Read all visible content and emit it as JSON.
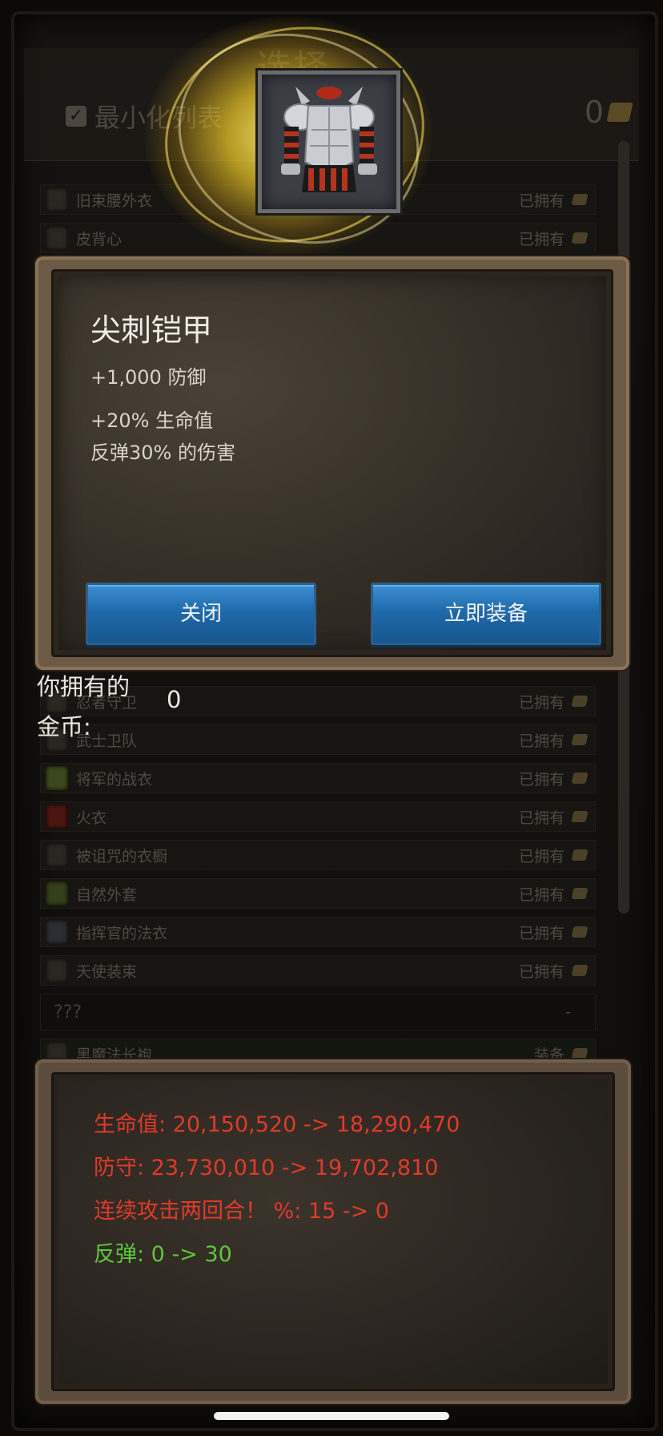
{
  "background": {
    "title": "选择",
    "minimize_label": "最小化列表",
    "gold_top": "0",
    "owned_gold_label": "你拥有的\n金币:",
    "owned_gold_value": "0",
    "list_top": [
      {
        "name": "旧束腰外衣",
        "status": "已拥有"
      },
      {
        "name": "皮背心",
        "status": "已拥有"
      }
    ],
    "list_bottom": [
      {
        "name": "忍者守卫",
        "status": "已拥有"
      },
      {
        "name": "武士卫队",
        "status": "已拥有"
      },
      {
        "name": "将军的战衣",
        "status": "已拥有"
      },
      {
        "name": "火衣",
        "status": "已拥有"
      },
      {
        "name": "被诅咒的衣橱",
        "status": "已拥有"
      },
      {
        "name": "自然外套",
        "status": "已拥有"
      },
      {
        "name": "指挥官的法衣",
        "status": "已拥有"
      },
      {
        "name": "天使装束",
        "status": "已拥有"
      }
    ],
    "unknown_row": {
      "name": "???",
      "status": "-"
    },
    "equipped_row": {
      "name": "黑魔法长袍",
      "status": "装备"
    }
  },
  "item": {
    "icon": "spiked-armor-icon",
    "name": "尖刺铠甲",
    "defense": "+1,000 防御",
    "hp_bonus": "+20% 生命值",
    "reflect": "反弹30% 的伤害"
  },
  "buttons": {
    "close": "关闭",
    "equip": "立即装备"
  },
  "stats": [
    {
      "text": "生命值: 20,150,520 -> 18,290,470",
      "color": "red"
    },
    {
      "text": "防守: 23,730,010 -> 19,702,810",
      "color": "red"
    },
    {
      "text": "连续攻击两回合！ %: 15 -> 0",
      "color": "red"
    },
    {
      "text": "反弹: 0 -> 30",
      "color": "green"
    }
  ],
  "colors": {
    "stat_red": "#e03a2a",
    "stat_green": "#5cc63b",
    "button_blue": "#1f6aab",
    "glow_yellow": "#ffe45a"
  }
}
